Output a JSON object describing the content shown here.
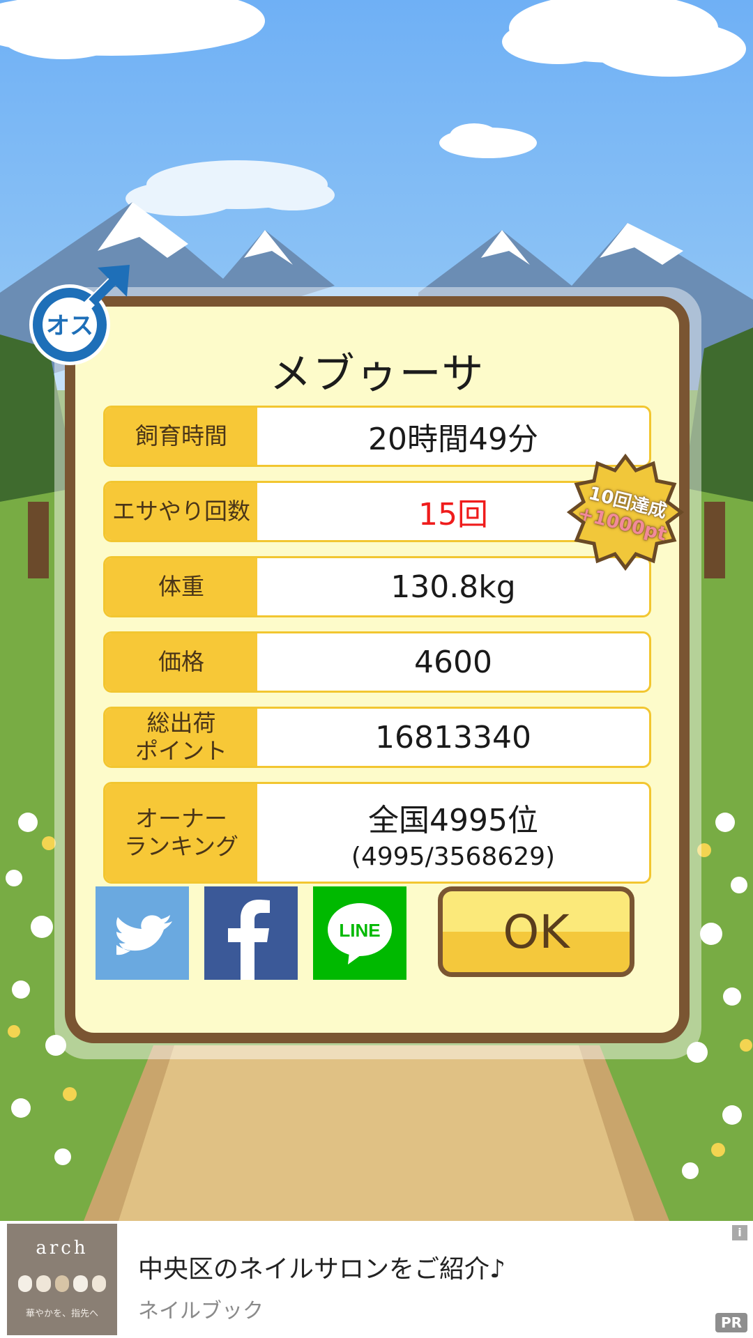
{
  "pet": {
    "name": "メブゥーサ",
    "gender_badge": "オス"
  },
  "stats": [
    {
      "label": "飼育時間",
      "value": "20時間49分"
    },
    {
      "label": "エサやり回数",
      "value": "15回"
    },
    {
      "label": "体重",
      "value": "130.8kg"
    },
    {
      "label": "価格",
      "value": "4600"
    },
    {
      "label": "総出荷\nポイント",
      "value": "16813340"
    },
    {
      "label": "オーナー\nランキング",
      "value": "全国4995位",
      "value_sub": "(4995/3568629)"
    }
  ],
  "achievement_badge": {
    "line1": "10回達成",
    "line2": "+1000pt"
  },
  "share": {
    "line_label": "LINE"
  },
  "ok_label": "OK",
  "ad": {
    "brand": "arch",
    "tagline": "華やかを、指先へ",
    "title": "中央区のネイルサロンをご紹介♪",
    "source": "ネイルブック",
    "info_mark": "i",
    "pr_label": "PR"
  },
  "colors": {
    "panel_border": "#7a5532",
    "panel_bg": "#fdfbca",
    "label_bg": "#f7c837",
    "highlight_value": "#ef1c1c",
    "twitter": "#6aa9e0",
    "facebook": "#3b5998",
    "line": "#00b900",
    "gender_blue": "#1e6fb8"
  }
}
